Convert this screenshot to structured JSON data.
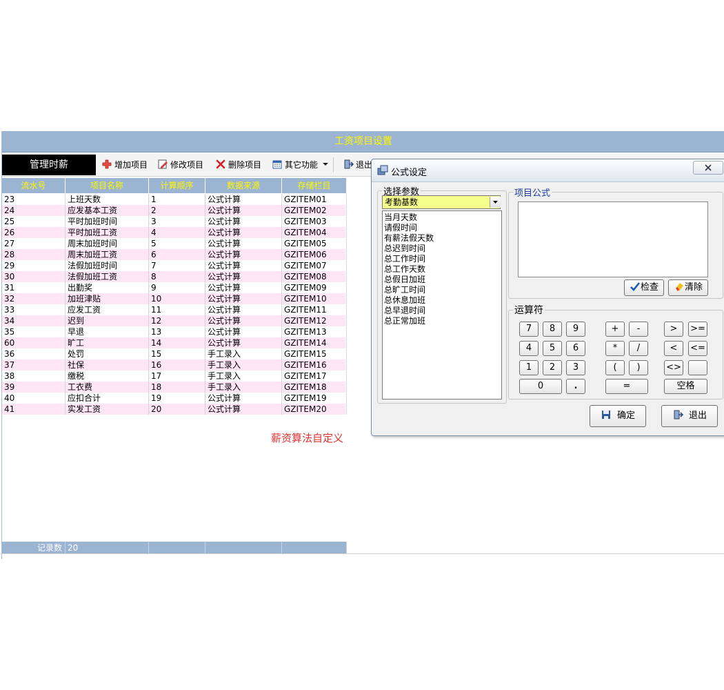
{
  "window": {
    "title": "工资项目设置"
  },
  "toolbar": {
    "module": "管理时薪",
    "add": "增加项目",
    "edit": "修改项目",
    "delete": "删除项目",
    "other": "其它功能",
    "exit": "退出"
  },
  "grid": {
    "columns": [
      "流水号",
      "项目名称",
      "计算顺序",
      "数据来源",
      "存储栏目"
    ],
    "rows": [
      [
        "23",
        "上班天数",
        "1",
        "公式计算",
        "GZITEM01"
      ],
      [
        "24",
        "应发基本工资",
        "2",
        "公式计算",
        "GZITEM02"
      ],
      [
        "25",
        "平时加班时间",
        "3",
        "公式计算",
        "GZITEM03"
      ],
      [
        "26",
        "平时加班工资",
        "4",
        "公式计算",
        "GZITEM04"
      ],
      [
        "27",
        "周末加班时间",
        "5",
        "公式计算",
        "GZITEM05"
      ],
      [
        "28",
        "周末加班工资",
        "6",
        "公式计算",
        "GZITEM06"
      ],
      [
        "29",
        "法假加班时间",
        "7",
        "公式计算",
        "GZITEM07"
      ],
      [
        "30",
        "法假加班工资",
        "8",
        "公式计算",
        "GZITEM08"
      ],
      [
        "31",
        "出勤奖",
        "9",
        "公式计算",
        "GZITEM09"
      ],
      [
        "32",
        "加班津贴",
        "10",
        "公式计算",
        "GZITEM10"
      ],
      [
        "33",
        "应发工资",
        "11",
        "公式计算",
        "GZITEM11"
      ],
      [
        "34",
        "迟到",
        "12",
        "公式计算",
        "GZITEM12"
      ],
      [
        "35",
        "早退",
        "13",
        "公式计算",
        "GZITEM13"
      ],
      [
        "60",
        "旷工",
        "14",
        "公式计算",
        "GZITEM14"
      ],
      [
        "36",
        "处罚",
        "15",
        "手工录入",
        "GZITEM15"
      ],
      [
        "37",
        "社保",
        "16",
        "手工录入",
        "GZITEM16"
      ],
      [
        "38",
        "缴税",
        "17",
        "手工录入",
        "GZITEM17"
      ],
      [
        "39",
        "工衣费",
        "18",
        "手工录入",
        "GZITEM18"
      ],
      [
        "40",
        "应扣合计",
        "19",
        "公式计算",
        "GZITEM19"
      ],
      [
        "41",
        "实发工资",
        "20",
        "公式计算",
        "GZITEM20"
      ]
    ],
    "footer_label": "记录数",
    "footer_count": "20"
  },
  "caption": "薪资算法自定义",
  "dialog": {
    "title": "公式设定",
    "param_group": "选择参数",
    "param_selected": "考勤基数",
    "params": [
      "当月天数",
      "请假时间",
      "有薪法假天数",
      "总迟到时间",
      "总工作时间",
      "总工作天数",
      "总假日加班",
      "总旷工时间",
      "总休息加班",
      "总早退时间",
      "总正常加班"
    ],
    "formula_group": "项目公式",
    "check": "检查",
    "clear": "清除",
    "operator_group": "运算符",
    "keys": {
      "k7": "7",
      "k8": "8",
      "k9": "9",
      "k4": "4",
      "k5": "5",
      "k6": "6",
      "k1": "1",
      "k2": "2",
      "k3": "3",
      "k0": "0",
      "dot": ".",
      "plus": "+",
      "minus": "-",
      "mul": "*",
      "div": "/",
      "lparen": "(",
      "rparen": ")",
      "eq": "=",
      "gt": ">",
      "gte": ">=",
      "lt": "<",
      "lte": "<=",
      "ne": "<>",
      "space": "空格"
    },
    "ok": "确定",
    "exit": "退出"
  },
  "colors": {
    "header_bg": "#9bb4d2",
    "header_text": "#fff700",
    "alt_row": "#ffe6f4",
    "select_bg": "#f4ff8c",
    "caption": "#e03030"
  }
}
